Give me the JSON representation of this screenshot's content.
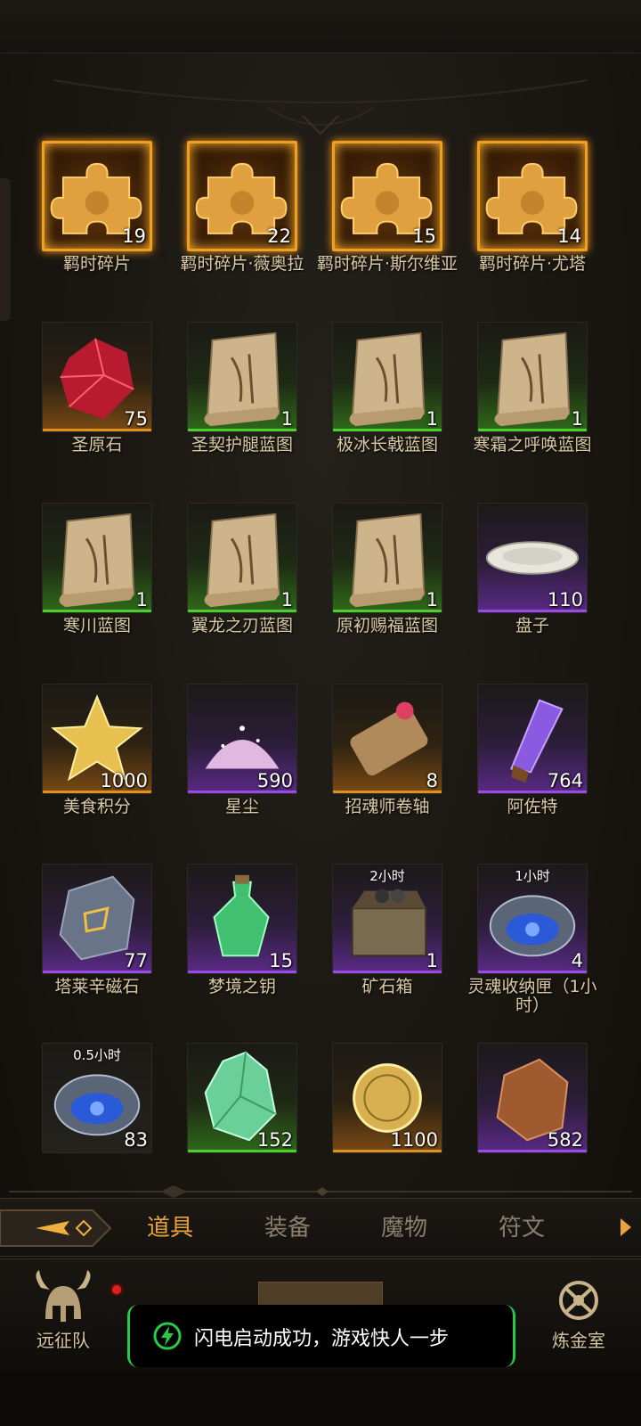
{
  "items": [
    {
      "label": "羁时碎片",
      "count": "19",
      "rarity": "gold",
      "icon": "puzzle-piece-icon"
    },
    {
      "label": "羁时碎片·薇奥拉",
      "count": "22",
      "rarity": "gold",
      "icon": "puzzle-piece-icon"
    },
    {
      "label": "羁时碎片·斯尔维亚",
      "count": "15",
      "rarity": "gold",
      "icon": "puzzle-piece-icon"
    },
    {
      "label": "羁时碎片·尤塔",
      "count": "14",
      "rarity": "gold",
      "icon": "puzzle-piece-icon"
    },
    {
      "label": "圣原石",
      "count": "75",
      "rarity": "orange",
      "icon": "red-gem-icon"
    },
    {
      "label": "圣契护腿蓝图",
      "count": "1",
      "rarity": "green",
      "icon": "blueprint-scroll-icon"
    },
    {
      "label": "极冰长戟蓝图",
      "count": "1",
      "rarity": "green",
      "icon": "blueprint-scroll-icon"
    },
    {
      "label": "寒霜之呼唤蓝图",
      "count": "1",
      "rarity": "green",
      "icon": "blueprint-scroll-icon"
    },
    {
      "label": "寒川蓝图",
      "count": "1",
      "rarity": "green",
      "icon": "blueprint-scroll-icon"
    },
    {
      "label": "翼龙之刃蓝图",
      "count": "1",
      "rarity": "green",
      "icon": "blueprint-scroll-icon"
    },
    {
      "label": "原初赐福蓝图",
      "count": "1",
      "rarity": "green",
      "icon": "blueprint-scroll-icon"
    },
    {
      "label": "盘子",
      "count": "110",
      "rarity": "purple",
      "icon": "plate-icon"
    },
    {
      "label": "美食积分",
      "count": "1000",
      "rarity": "orange",
      "icon": "gold-star-icon"
    },
    {
      "label": "星尘",
      "count": "590",
      "rarity": "purple",
      "icon": "stardust-icon"
    },
    {
      "label": "招魂师卷轴",
      "count": "8",
      "rarity": "orange",
      "icon": "scroll-icon"
    },
    {
      "label": "阿佐特",
      "count": "764",
      "rarity": "purple",
      "icon": "crystal-vial-icon"
    },
    {
      "label": "塔莱辛磁石",
      "count": "77",
      "rarity": "purple",
      "icon": "lodestone-icon"
    },
    {
      "label": "梦境之钥",
      "count": "15",
      "rarity": "purple",
      "icon": "green-potion-icon"
    },
    {
      "label": "矿石箱",
      "count": "1",
      "rarity": "purple",
      "icon": "ore-chest-icon",
      "timer": "2小时"
    },
    {
      "label": "灵魂收纳匣（1小时）",
      "count": "4",
      "rarity": "purple",
      "icon": "soul-box-icon",
      "timer": "1小时"
    },
    {
      "label": "",
      "count": "83",
      "rarity": "none",
      "icon": "soul-box-icon",
      "timer": "0.5小时"
    },
    {
      "label": "",
      "count": "152",
      "rarity": "green",
      "icon": "green-crystal-icon"
    },
    {
      "label": "",
      "count": "1100",
      "rarity": "orange",
      "icon": "gold-coin-icon"
    },
    {
      "label": "",
      "count": "582",
      "rarity": "purple",
      "icon": "amber-stone-icon"
    }
  ],
  "tabs": [
    {
      "label": "道具",
      "active": true
    },
    {
      "label": "装备",
      "active": false
    },
    {
      "label": "魔物",
      "active": false
    },
    {
      "label": "符文",
      "active": false
    }
  ],
  "nav": {
    "left_label": "远征队",
    "right_label": "炼金室"
  },
  "toast": {
    "text": "闪电启动成功，游戏快人一步",
    "accent": "#27c94a"
  },
  "colors": {
    "gold": "#f0a020",
    "green": "#4bcf2a",
    "purple": "#9a4ae6",
    "orange": "#e0901c",
    "active_tab": "#e8a23a"
  }
}
